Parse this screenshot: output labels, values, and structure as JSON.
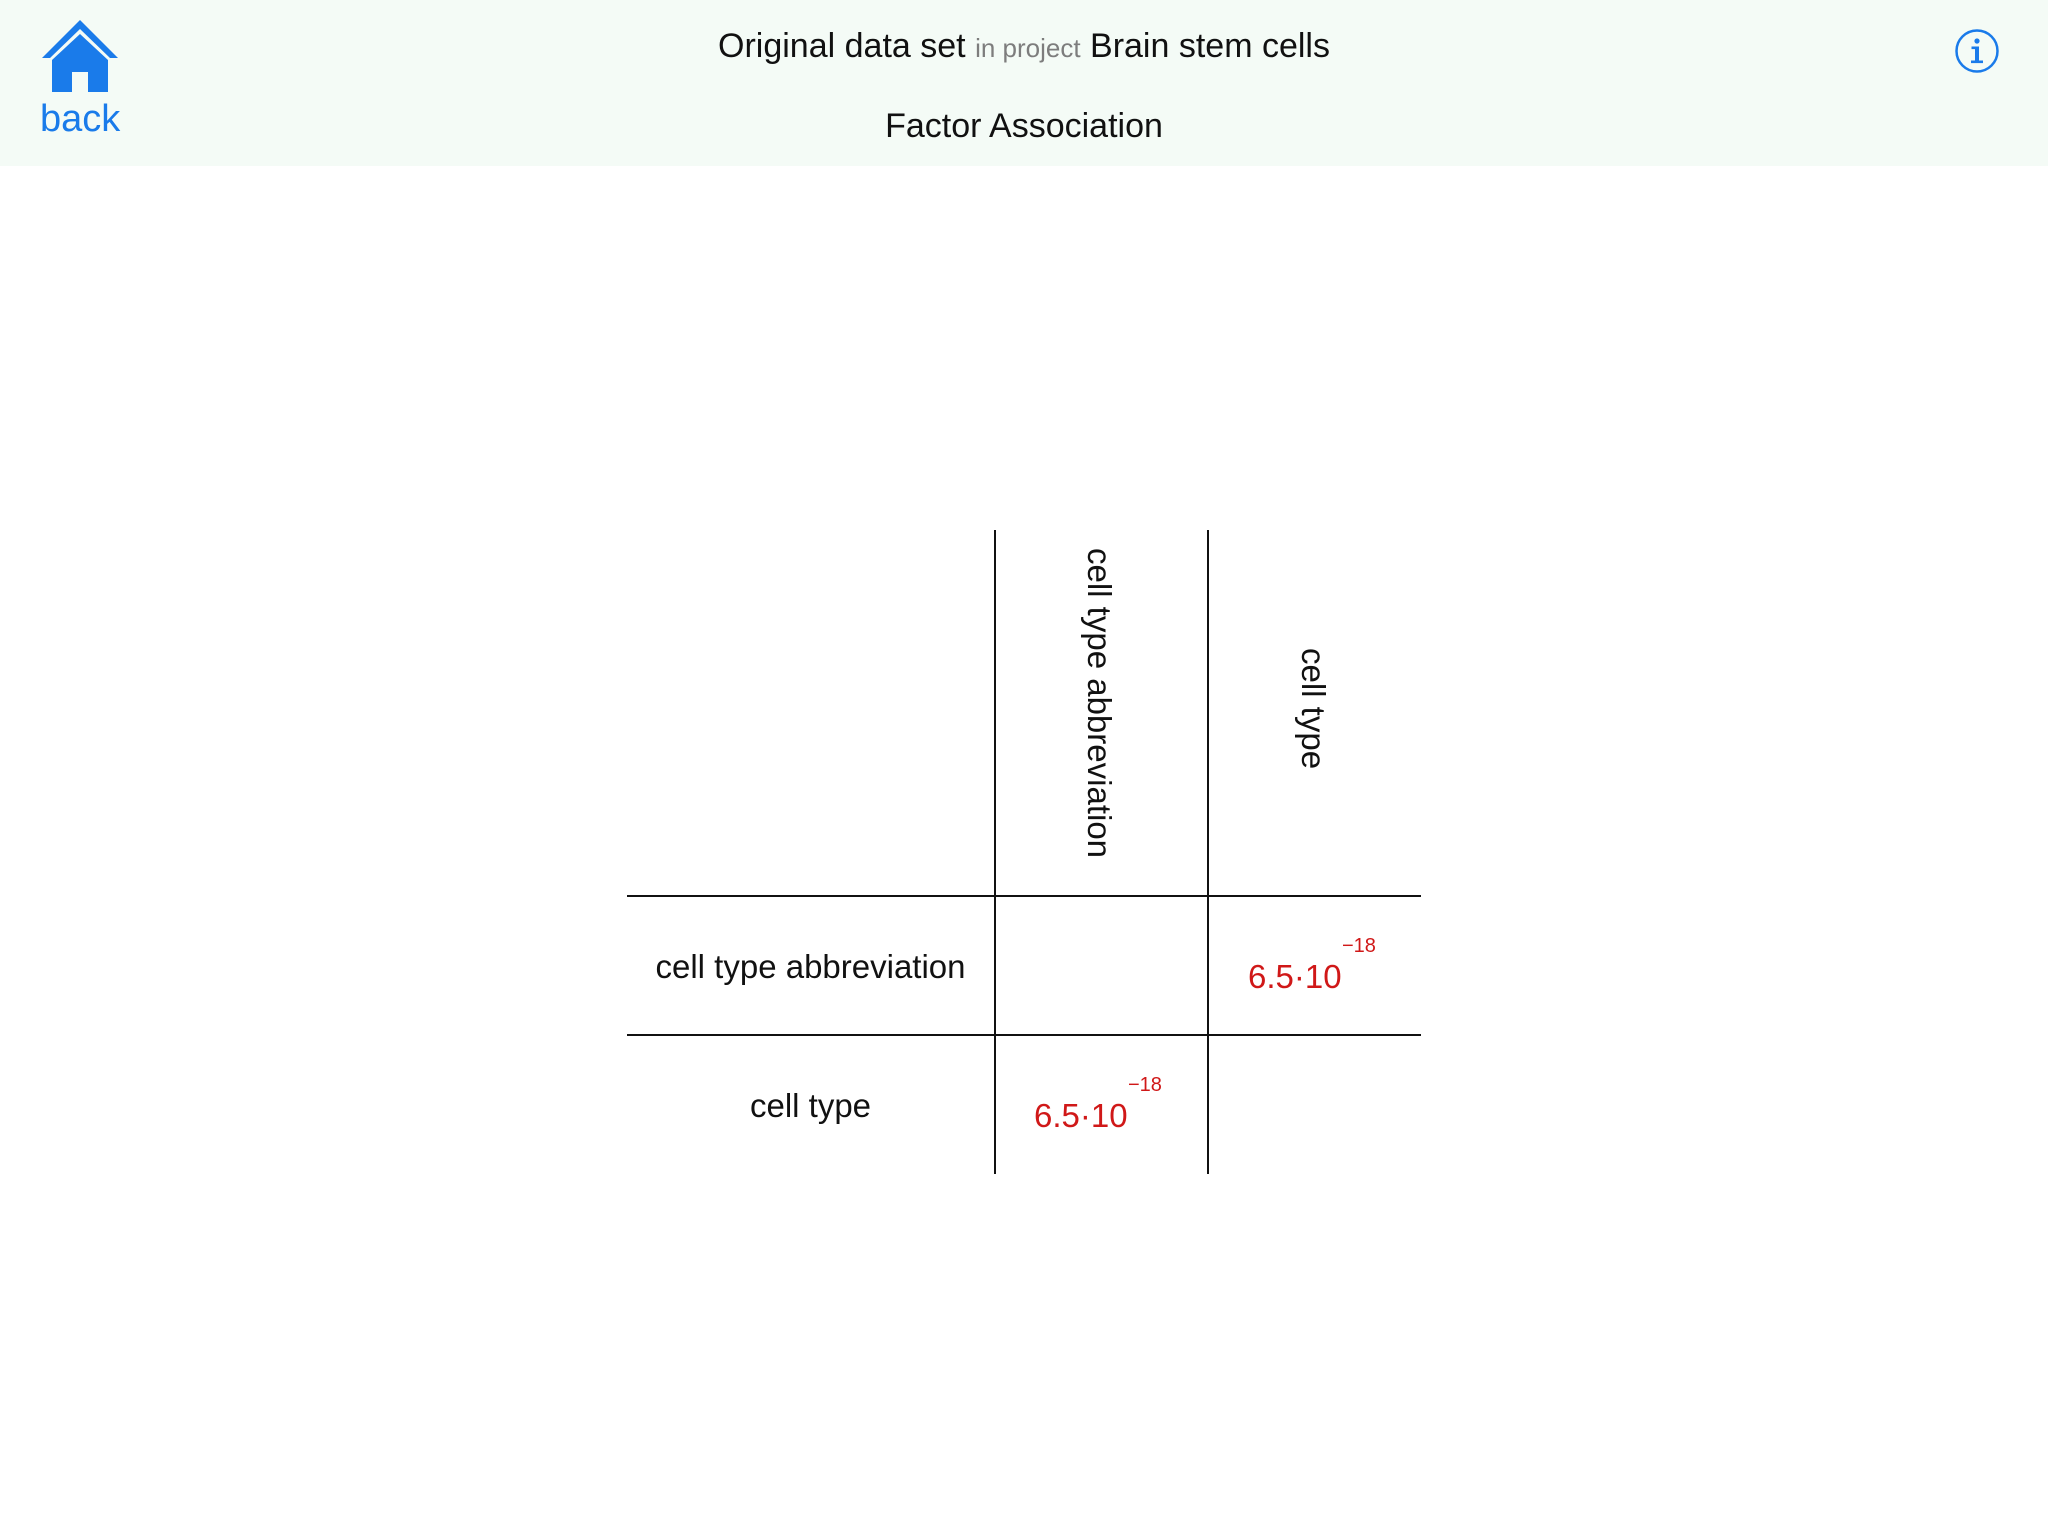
{
  "header": {
    "back_label": "back",
    "dataset_name": "Original data set",
    "connector": "in project",
    "project_name": "Brain stem cells",
    "subtitle": "Factor Association",
    "home_icon": "home-icon",
    "info_icon": "info-icon",
    "accent_color": "#1a7bea"
  },
  "matrix": {
    "columns": [
      "cell type abbreviation",
      "cell type"
    ],
    "rows": [
      {
        "label": "cell type abbreviation",
        "cells": [
          {
            "mantissa": "",
            "exponent": ""
          },
          {
            "mantissa": "6.5·10",
            "exponent": "−18"
          }
        ]
      },
      {
        "label": "cell type",
        "cells": [
          {
            "mantissa": "6.5·10",
            "exponent": "−18"
          },
          {
            "mantissa": "",
            "exponent": ""
          }
        ]
      }
    ],
    "value_color": "#d01818"
  }
}
